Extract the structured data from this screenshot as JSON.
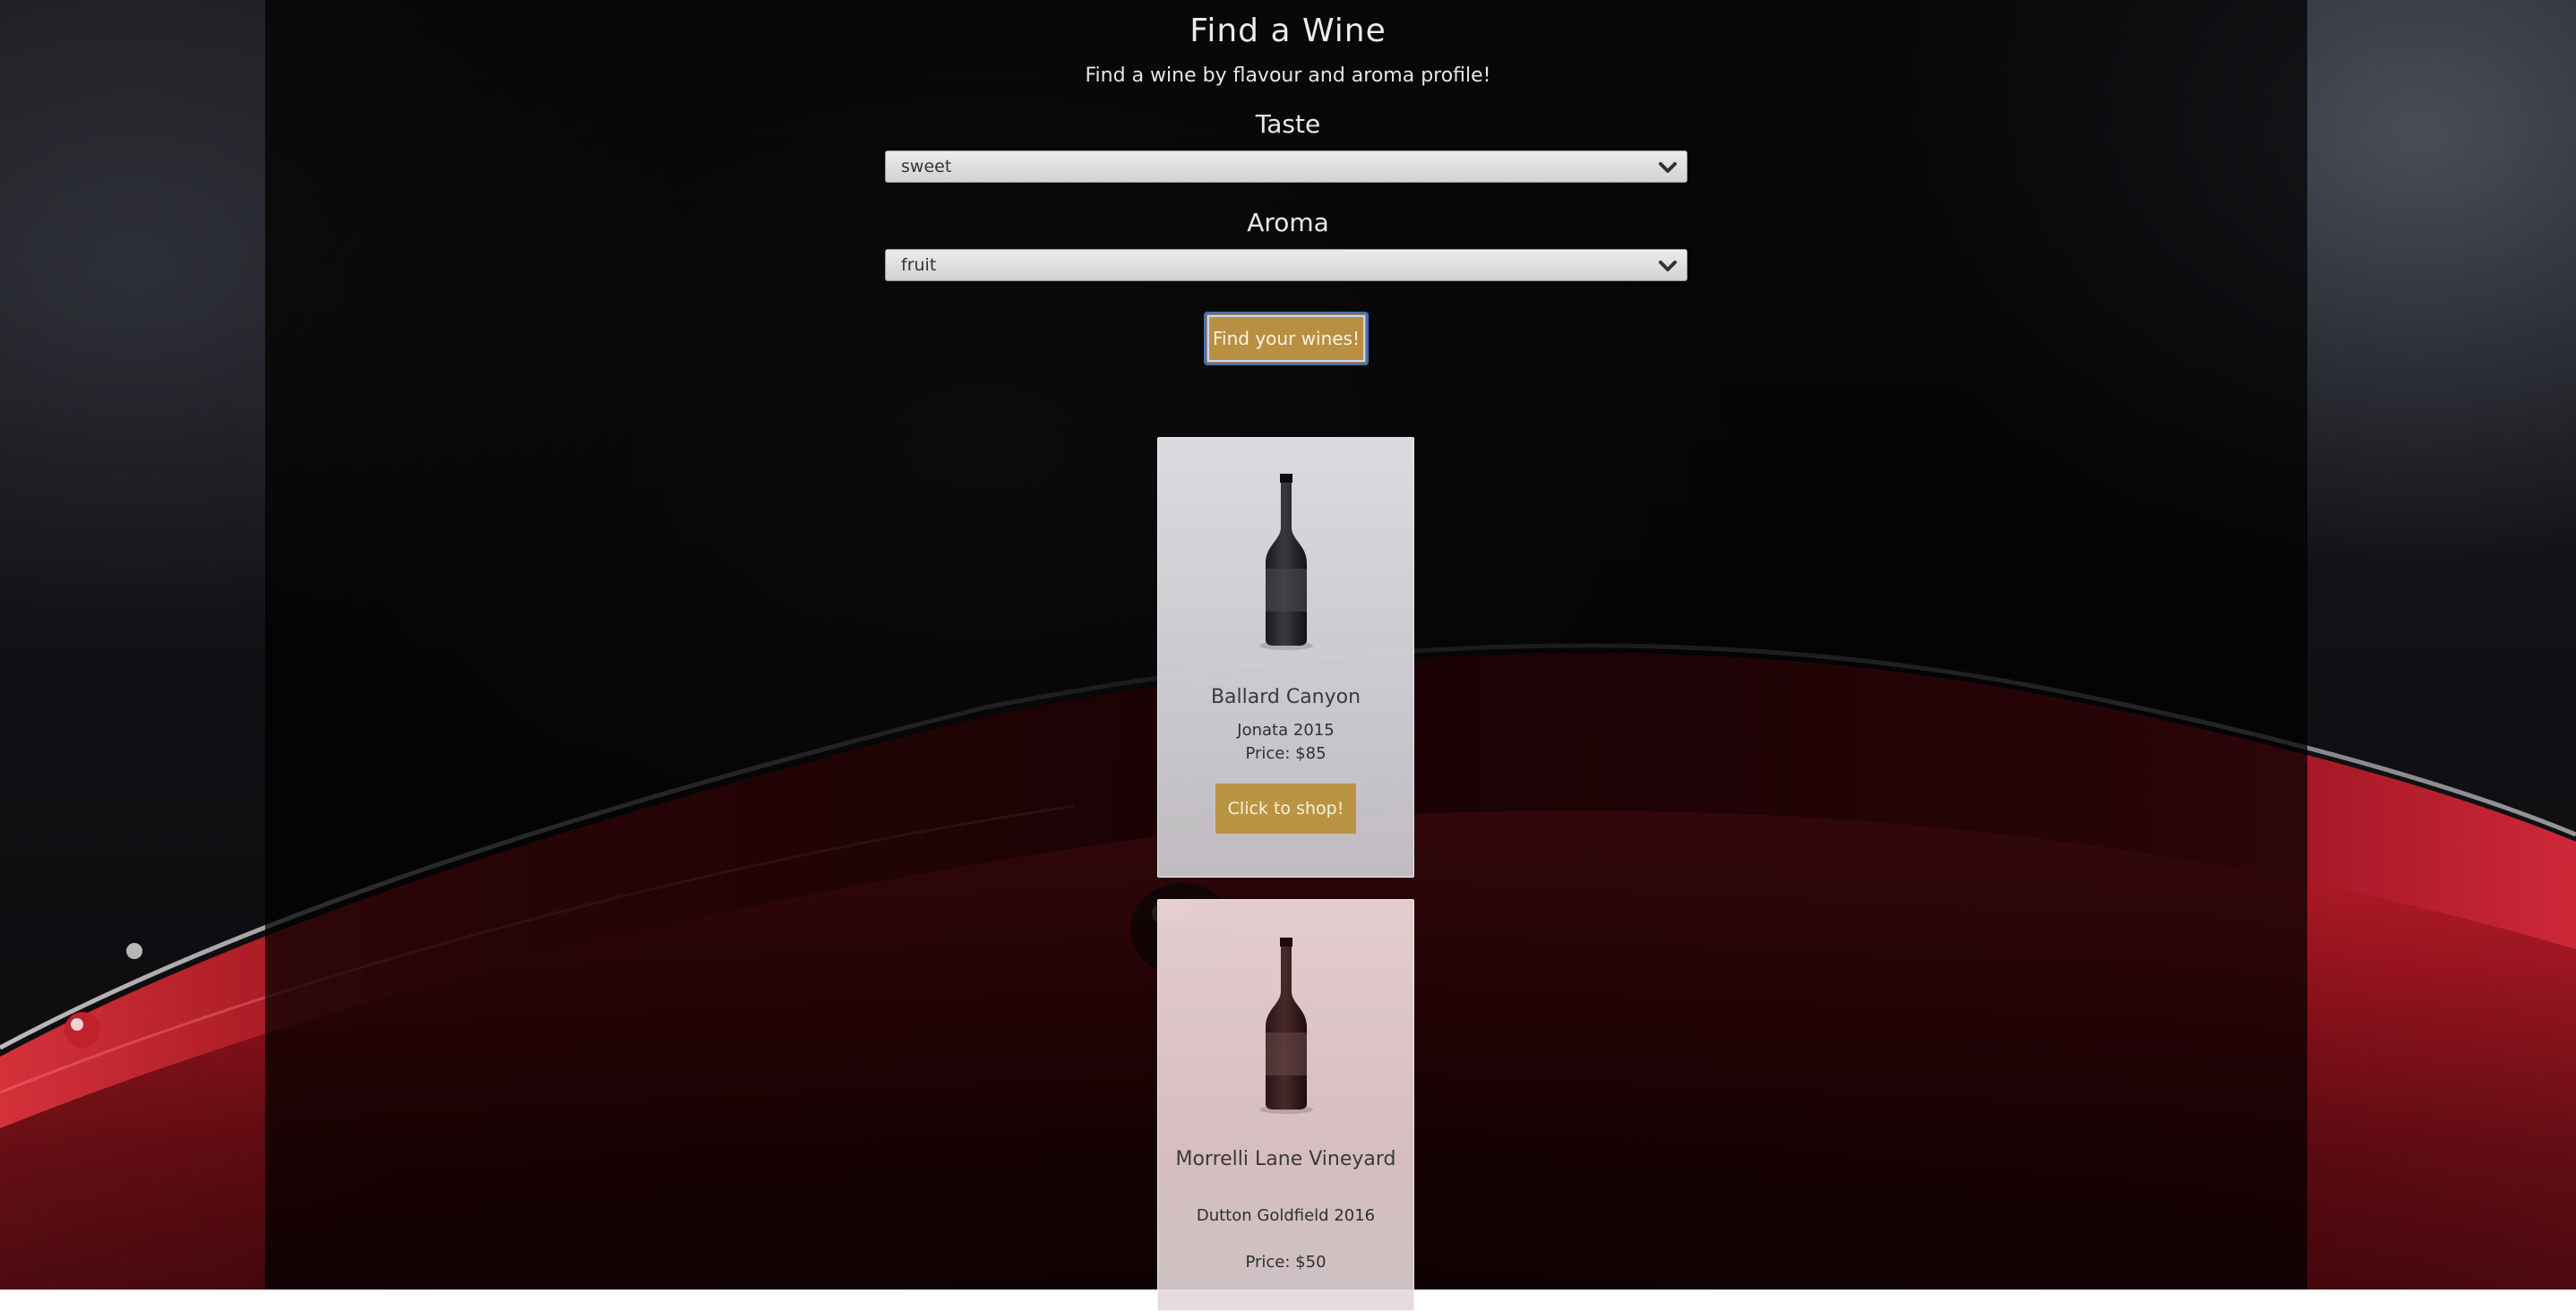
{
  "header": {
    "title": "Find a Wine",
    "subtitle": "Find a wine by flavour and aroma profile!"
  },
  "filters": {
    "taste": {
      "label": "Taste",
      "selected": "sweet"
    },
    "aroma": {
      "label": "Aroma",
      "selected": "fruit"
    },
    "submit_label": "Find your wines!"
  },
  "results": [
    {
      "name": "Ballard Canyon",
      "producer": "Jonata 2015",
      "price": "Price: $85",
      "shop_label": "Click to shop!"
    },
    {
      "name": "Morrelli Lane Vineyard",
      "producer": "Dutton Goldfield 2016",
      "price": "Price: $50"
    }
  ],
  "colors": {
    "accent": "#b99043",
    "focus_ring": "#4d6fb0",
    "wine_red": "#b01e28"
  },
  "icons": {
    "select_arrow": "chevron-down-icon",
    "product_image": "wine-bottle-icon"
  }
}
